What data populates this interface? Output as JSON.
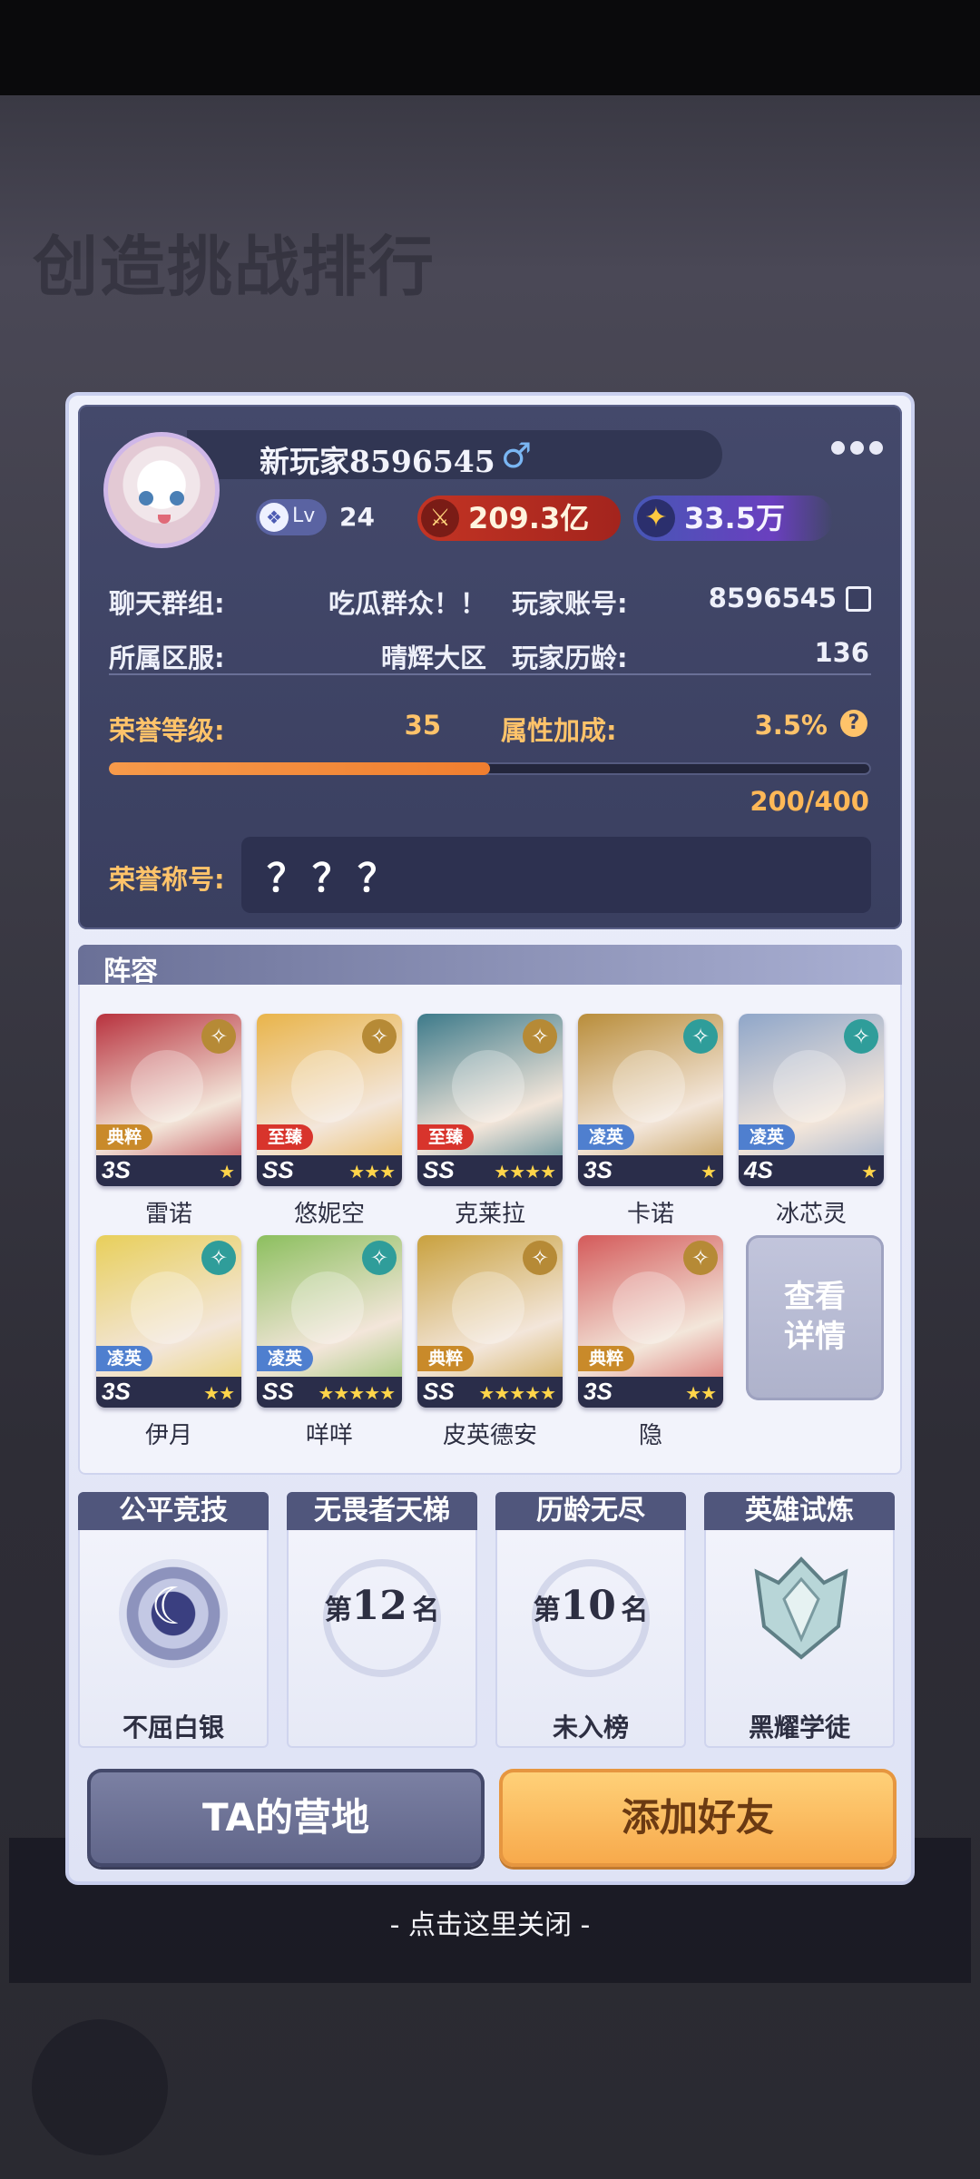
{
  "background": {
    "title": "创造挑战排行"
  },
  "profile": {
    "player_name": "新玩家8596545",
    "gender_symbol": "♂",
    "level_label": "Lv",
    "level": "24",
    "power": "209.3亿",
    "rank_points": "33.5万",
    "chat_group_label": "聊天群组:",
    "chat_group": "吃瓜群众！！",
    "account_label": "玩家账号:",
    "account": "8596545",
    "server_label": "所属区服:",
    "server": "晴辉大区",
    "age_label": "玩家历龄:",
    "age": "136",
    "honor_level_label": "荣誉等级:",
    "honor_level": "35",
    "attr_bonus_label": "属性加成:",
    "attr_bonus": "3.5%",
    "honor_progress_text": "200/400",
    "honor_progress_fraction": 0.5,
    "honor_title_label": "荣誉称号:",
    "honor_title": "？？？"
  },
  "lineup": {
    "title": "阵容",
    "heroes": [
      {
        "name": "雷诺",
        "rarity": "典粹",
        "grade": "3S",
        "stars": "★",
        "color": "#b8323e"
      },
      {
        "name": "悠妮空",
        "rarity": "至臻",
        "grade": "SS",
        "stars": "★★★",
        "color": "#e9b44a"
      },
      {
        "name": "克莱拉",
        "rarity": "至臻",
        "grade": "SS",
        "stars": "★★★★",
        "color": "#3d7a8a"
      },
      {
        "name": "卡诺",
        "rarity": "凌英",
        "grade": "3S",
        "stars": "★",
        "color": "#b98d3a"
      },
      {
        "name": "冰芯灵",
        "rarity": "凌英",
        "grade": "4S",
        "stars": "★",
        "color": "#8fa6c9"
      },
      {
        "name": "伊月",
        "rarity": "凌英",
        "grade": "3S",
        "stars": "★★",
        "color": "#e8cf5a"
      },
      {
        "name": "咩咩",
        "rarity": "凌英",
        "grade": "SS",
        "stars": "★★★★★",
        "color": "#8cbf5e"
      },
      {
        "name": "皮英德安",
        "rarity": "典粹",
        "grade": "SS",
        "stars": "★★★★★",
        "color": "#c9a13e"
      },
      {
        "name": "隐",
        "rarity": "典粹",
        "grade": "3S",
        "stars": "★★",
        "color": "#d45a5a"
      }
    ],
    "view_detail": "查看详情"
  },
  "ranks": [
    {
      "title": "公平竞技",
      "result": "不屈白银"
    },
    {
      "title": "无畏者天梯",
      "place_prefix": "第",
      "place": "12",
      "place_suffix": "名",
      "result": ""
    },
    {
      "title": "历龄无尽",
      "place_prefix": "第",
      "place": "10",
      "place_suffix": "名",
      "result": "未入榜"
    },
    {
      "title": "英雄试炼",
      "result": "黑耀学徒"
    }
  ],
  "buttons": {
    "camp": "TA的营地",
    "add_friend": "添加好友"
  },
  "close_hint": "- 点击这里关闭 -"
}
